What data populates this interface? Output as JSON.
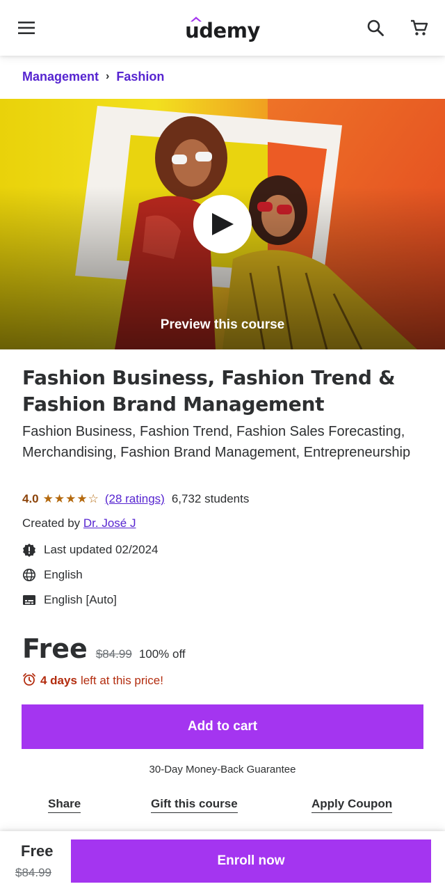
{
  "header": {
    "logo_text": "udemy",
    "brand_color": "#a435f0",
    "icons": [
      "menu-icon",
      "search-icon",
      "cart-icon"
    ]
  },
  "breadcrumb": [
    "Management",
    "Fashion"
  ],
  "hero": {
    "preview_label": "Preview this course"
  },
  "course": {
    "title": "Fashion Business, Fashion Trend & Fashion Brand Management",
    "subtitle": "Fashion Business, Fashion Trend, Fashion Sales Forecasting, Merchandising, Fashion Brand Management, Entrepreneurship",
    "rating": "4.0",
    "stars_display": "★★★★☆",
    "stars_value": 4,
    "ratings_link": "(28 ratings)",
    "students": "6,732 students",
    "created_by_prefix": "Created by",
    "creator": "Dr. José J",
    "last_updated": "Last updated 02/2024",
    "language": "English",
    "captions": "English [Auto]"
  },
  "pricing": {
    "current": "Free",
    "original": "$84.99",
    "discount": "100% off",
    "countdown_bold": "4 days",
    "countdown_rest": "left at this price!"
  },
  "actions": {
    "add_to_cart": "Add to cart",
    "guarantee": "30-Day Money-Back Guarantee",
    "share": "Share",
    "gift": "Gift this course",
    "coupon": "Apply Coupon"
  },
  "bottom_bar": {
    "price": "Free",
    "original": "$84.99",
    "enroll": "Enroll now"
  }
}
